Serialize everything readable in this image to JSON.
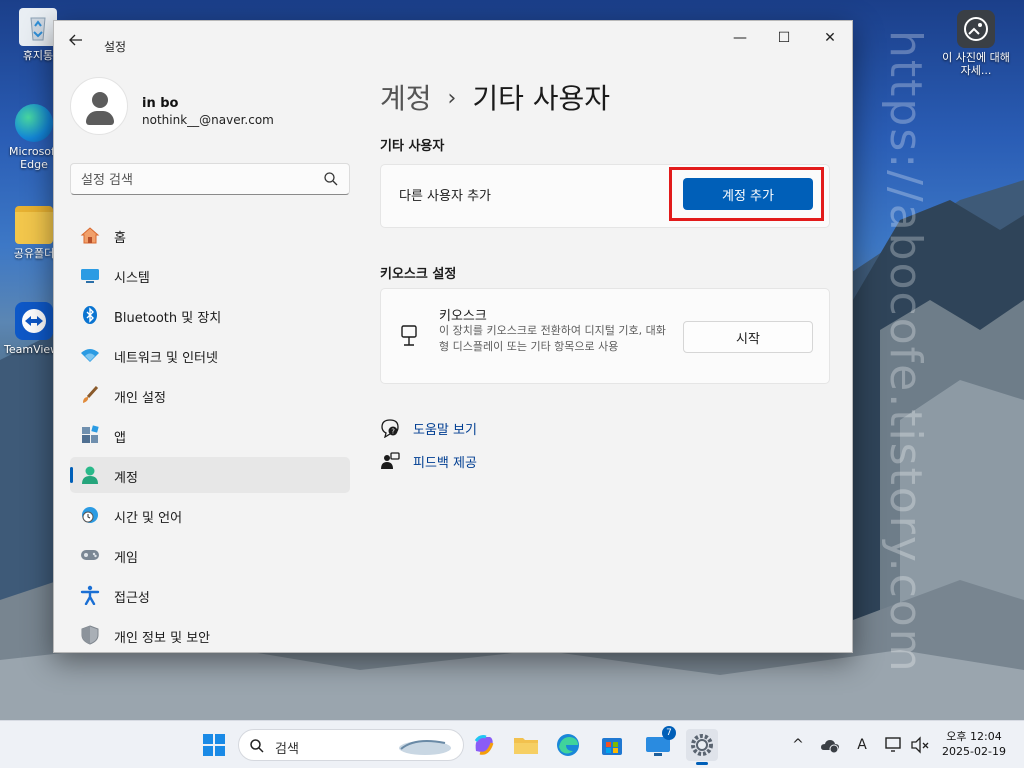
{
  "desktop": {
    "icons": [
      {
        "label": "휴지통",
        "icon": "recycle-bin-icon"
      },
      {
        "label": "Microsoft Edge",
        "icon": "edge-icon"
      },
      {
        "label": "공유폴더",
        "icon": "folder-icon"
      },
      {
        "label": "TeamViewer",
        "icon": "teamviewer-icon"
      },
      {
        "label": "이 사진에 대해 자세...",
        "icon": "learn-about-picture-icon"
      }
    ],
    "watermark": "https://abocofe.tistory.com"
  },
  "window": {
    "title": "설정",
    "controls": {
      "minimize": "—",
      "maximize": "☐",
      "close": "✕"
    }
  },
  "profile": {
    "name": "in bo",
    "email": "nothink__@naver.com"
  },
  "search": {
    "placeholder": "설정 검색"
  },
  "nav": {
    "items": [
      {
        "label": "홈",
        "icon": "home-icon",
        "color": "#e0703a"
      },
      {
        "label": "시스템",
        "icon": "system-icon",
        "color": "#1f8fd6"
      },
      {
        "label": "Bluetooth 및 장치",
        "icon": "bluetooth-icon",
        "color": "#0078d4"
      },
      {
        "label": "네트워크 및 인터넷",
        "icon": "wifi-icon",
        "color": "#1f8fd6"
      },
      {
        "label": "개인 설정",
        "icon": "brush-icon",
        "color": "#d37c2c"
      },
      {
        "label": "앱",
        "icon": "apps-icon",
        "color": "#4a6b8a"
      },
      {
        "label": "계정",
        "icon": "account-icon",
        "color": "#20b48a"
      },
      {
        "label": "시간 및 언어",
        "icon": "time-language-icon",
        "color": "#1f8fd6"
      },
      {
        "label": "게임",
        "icon": "gaming-icon",
        "color": "#6e7a86"
      },
      {
        "label": "접근성",
        "icon": "accessibility-icon",
        "color": "#1f6fd6"
      },
      {
        "label": "개인 정보 및 보안",
        "icon": "shield-icon",
        "color": "#8a8f96"
      }
    ],
    "active_index": 6
  },
  "content": {
    "breadcrumb_parent": "계정",
    "breadcrumb_sep": "›",
    "breadcrumb_current": "기타 사용자",
    "other_users": {
      "heading": "기타 사용자",
      "row_label": "다른 사용자 추가",
      "button": "계정 추가"
    },
    "kiosk": {
      "heading": "키오스크 설정",
      "title": "키오스크",
      "description": "이 장치를 키오스크로 전환하여 디지털 기호, 대화형 디스플레이 또는 기타 항목으로 사용",
      "button": "시작"
    },
    "links": {
      "help": "도움말 보기",
      "feedback": "피드백 제공"
    }
  },
  "taskbar": {
    "search_label": "검색",
    "badge_count": "7",
    "tray": {
      "chevron": "^",
      "ime": "A"
    },
    "clock_time": "오후 12:04",
    "clock_date": "2025-02-19",
    "accent": "#005fb8"
  }
}
